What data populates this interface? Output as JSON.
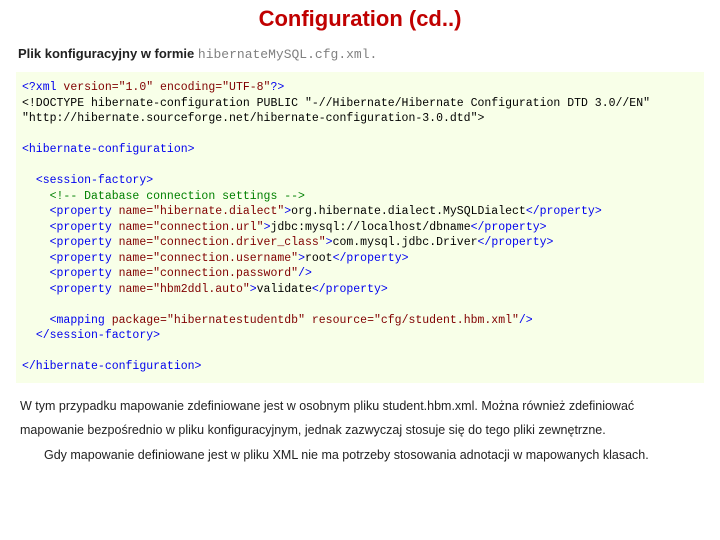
{
  "title": "Configuration (cd..)",
  "intro_text": "Plik konfiguracyjny w formie ",
  "intro_mono": "hibernateMySQL.cfg.xml.",
  "code": {
    "xml_decl_open": "<?xml ",
    "xml_decl_attrs": "version=\"1.0\" encoding=\"UTF-8\"",
    "xml_decl_close": "?>",
    "doctype": "<!DOCTYPE hibernate-configuration PUBLIC \"-//Hibernate/Hibernate Configuration DTD 3.0//EN\" \"http://hibernate.sourceforge.net/hibernate-configuration-3.0.dtd\">",
    "hib_conf_open": "<hibernate-configuration>",
    "session_open": "  <session-factory>",
    "comment": "    <!-- Database connection settings -->",
    "p1_open": "    <property ",
    "p1_attr": "name=\"hibernate.dialect\"",
    "p1_mid": ">",
    "p1_val": "org.hibernate.dialect.MySQLDialect",
    "p1_close": "</property>",
    "p2_open": "    <property ",
    "p2_attr": "name=\"connection.url\"",
    "p2_mid": ">",
    "p2_val": "jdbc:mysql://localhost/dbname",
    "p2_close": "</property>",
    "p3_open": "    <property ",
    "p3_attr": "name=\"connection.driver_class\"",
    "p3_mid": ">",
    "p3_val": "com.mysql.jdbc.Driver",
    "p3_close": "</property>",
    "p4_open": "    <property ",
    "p4_attr": "name=\"connection.username\"",
    "p4_mid": ">",
    "p4_val": "root",
    "p4_close": "</property>",
    "p5_open": "    <property ",
    "p5_attr": "name=\"connection.password\"",
    "p5_close": "/>",
    "p6_open": "    <property ",
    "p6_attr": "name=\"hbm2ddl.auto\"",
    "p6_mid": ">",
    "p6_val": "validate",
    "p6_close": "</property>",
    "map_open": "    <mapping ",
    "map_attrs": "package=\"hibernatestudentdb\" resource=\"cfg/student.hbm.xml\"",
    "map_close": "/>",
    "session_close": "  </session-factory>",
    "hib_conf_close": "</hibernate-configuration>"
  },
  "para1": "W tym przypadku mapowanie zdefiniowane jest w osobnym pliku student.hbm.xml. Można również zdefiniować mapowanie bezpośrednio w pliku konfiguracyjnym, jednak zazwyczaj stosuje się do tego pliki zewnętrzne.",
  "para2": "Gdy mapowanie definiowane jest w pliku XML nie ma potrzeby stosowania adnotacji w mapowanych klasach."
}
